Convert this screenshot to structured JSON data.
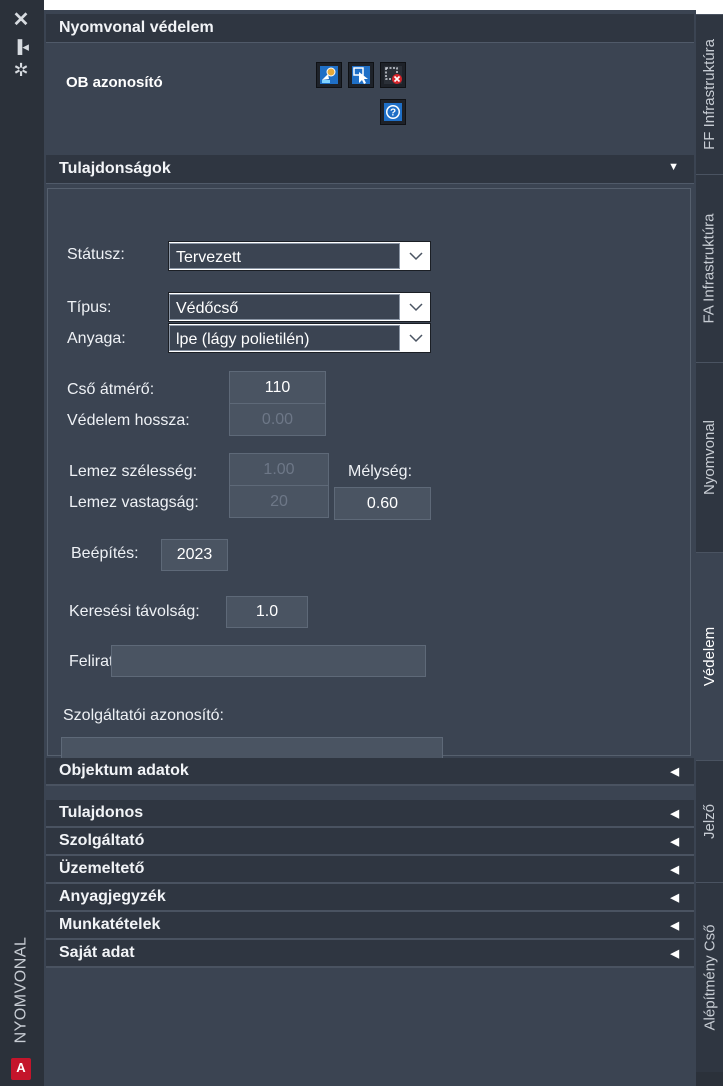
{
  "sidebar": {
    "vertical_title": "NYOMVONAL",
    "logo_letter": "A"
  },
  "panel": {
    "title": "Nyomvonal védelem",
    "ob_label": "OB azonosító",
    "toolbar": {
      "icons": [
        "pick-object-icon",
        "select-cursor-icon",
        "delete-object-icon",
        "help-icon"
      ]
    }
  },
  "properties": {
    "header": "Tulajdonságok",
    "status_label": "Státusz:",
    "status_value": "Tervezett",
    "type_label": "Típus:",
    "type_value": "Védőcső",
    "material_label": "Anyaga:",
    "material_value": "lpe (lágy polietilén)",
    "pipe_diameter_label": "Cső átmérő:",
    "pipe_diameter_value": "110",
    "protection_length_label": "Védelem hossza:",
    "protection_length_value": "0.00",
    "plate_width_label": "Lemez szélesség:",
    "plate_width_value": "1.00",
    "depth_label": "Mélység:",
    "plate_thickness_label": "Lemez vastagság:",
    "plate_thickness_value": "20",
    "depth_value": "0.60",
    "install_label": "Beépítés:",
    "install_value": "2023",
    "search_distance_label": "Keresési távolság:",
    "search_distance_value": "1.0",
    "caption_label": "Felirat:",
    "caption_value": "",
    "provider_id_label": "Szolgáltatói azonosító:",
    "provider_id_value": ""
  },
  "sections": [
    "Objektum adatok",
    "Tulajdonos",
    "Szolgáltató",
    "Üzemeltető",
    "Anyagjegyzék",
    "Munkatételek",
    "Saját adat"
  ],
  "right_tabs": [
    "FF Infrastruktúra",
    "FA Infrastruktúra",
    "Nyomvonal",
    "Védelem",
    "Jelző",
    "Alépítmény Cső"
  ],
  "active_tab": "Védelem",
  "colors": {
    "panel_bg": "#3b4452",
    "header_bg": "#2f3641",
    "accent_logo": "#c4152b"
  }
}
